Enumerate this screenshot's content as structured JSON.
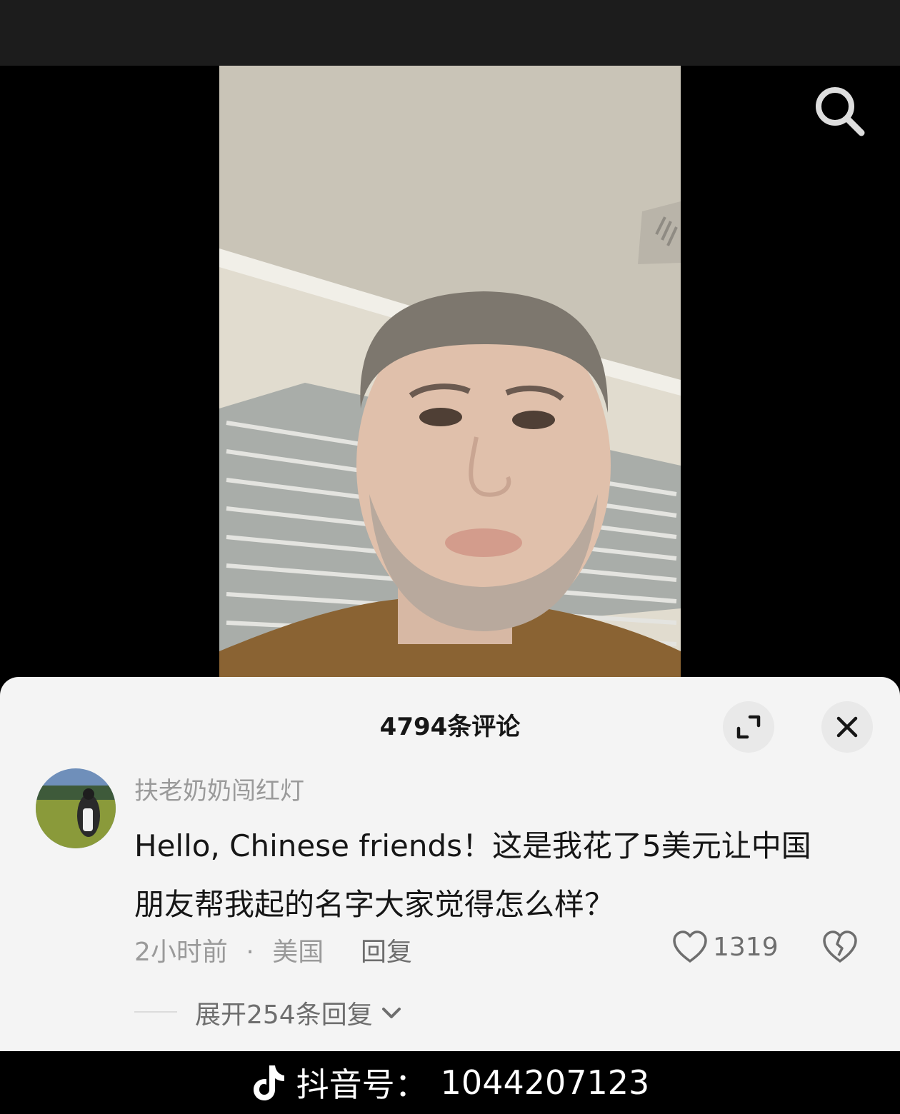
{
  "comments_sheet": {
    "title": "4794条评论",
    "comment": {
      "username": "扶老奶奶闯红灯",
      "text_line1": "Hello, Chinese friends！这是我花了5美元让中国",
      "text_line2": "朋友帮我起的名字大家觉得怎么样？",
      "time": "2小时前",
      "separator": "·",
      "location": "美国",
      "reply_label": "回复",
      "like_count": "1319",
      "expand_replies_label": "展开254条回复"
    }
  },
  "watermark": {
    "platform_label": "抖音号：",
    "account_id": "1044207123"
  },
  "icons": {
    "search": "search-icon",
    "expand": "expand-icon",
    "close": "close-icon",
    "like": "heart-outline-icon",
    "dislike": "broken-heart-icon",
    "chevron": "chevron-down-icon",
    "logo": "douyin-logo-icon"
  }
}
